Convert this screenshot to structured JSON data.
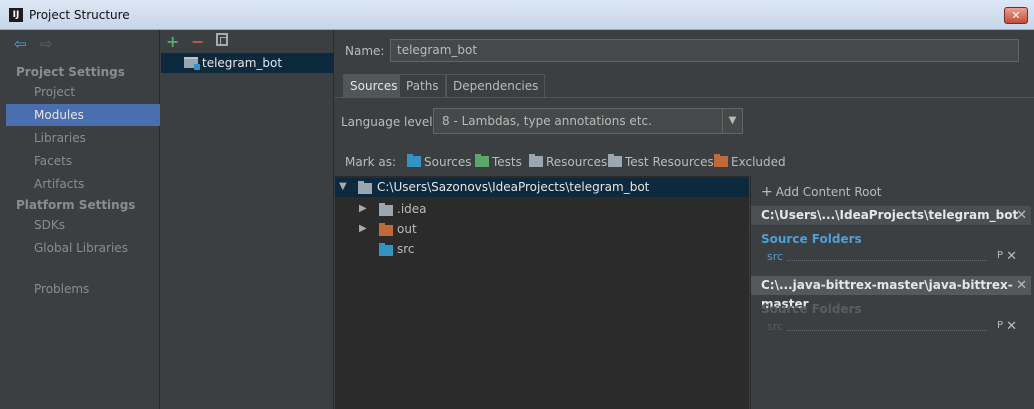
{
  "window": {
    "title": "Project Structure",
    "close_label": "✕"
  },
  "nav": {
    "groups": [
      "Project Settings",
      "Platform Settings"
    ],
    "items": [
      "Project",
      "Modules",
      "Libraries",
      "Facets",
      "Artifacts",
      "SDKs",
      "Global Libraries",
      "Problems"
    ],
    "selected": "Modules"
  },
  "modules": {
    "list": [
      "telegram_bot"
    ]
  },
  "editor": {
    "name_label": "Name:",
    "name_value": "telegram_bot",
    "tabs": [
      "Sources",
      "Paths",
      "Dependencies"
    ],
    "active_tab": "Sources",
    "language_label": "Language level:",
    "language_value": "8 - Lambdas, type annotations etc.",
    "mark_as_label": "Mark as:",
    "mark_as": [
      {
        "label": "Sources",
        "color": "#3592c4"
      },
      {
        "label": "Tests",
        "color": "#59a869"
      },
      {
        "label": "Resources",
        "color": "#9aa7b0"
      },
      {
        "label": "Test Resources",
        "color": "#9aa7b0"
      },
      {
        "label": "Excluded",
        "color": "#c26a35"
      }
    ]
  },
  "tree": {
    "root": "C:\\Users\\Sazonovs\\IdeaProjects\\telegram_bot",
    "children": [
      {
        "label": ".idea",
        "expandable": true,
        "color": "#9aa7b0"
      },
      {
        "label": "out",
        "expandable": true,
        "color": "#c26a35"
      },
      {
        "label": "src",
        "expandable": false,
        "color": "#3592c4"
      }
    ]
  },
  "content_roots": {
    "add_label": "Add Content Root",
    "roots": [
      {
        "path": "C:\\Users\\...\\IdeaProjects\\telegram_bot",
        "section": "Source Folders",
        "folder": "src",
        "active": true
      },
      {
        "path": "C:\\...java-bittrex-master\\java-bittrex-master",
        "section": "Source Folders",
        "folder": "src",
        "active": false
      }
    ],
    "p_label": "P",
    "x_label": "✕"
  },
  "colors": {
    "accent": "#4b6eaf",
    "selection": "#0d293e",
    "source_blue": "#4e9ed8"
  }
}
